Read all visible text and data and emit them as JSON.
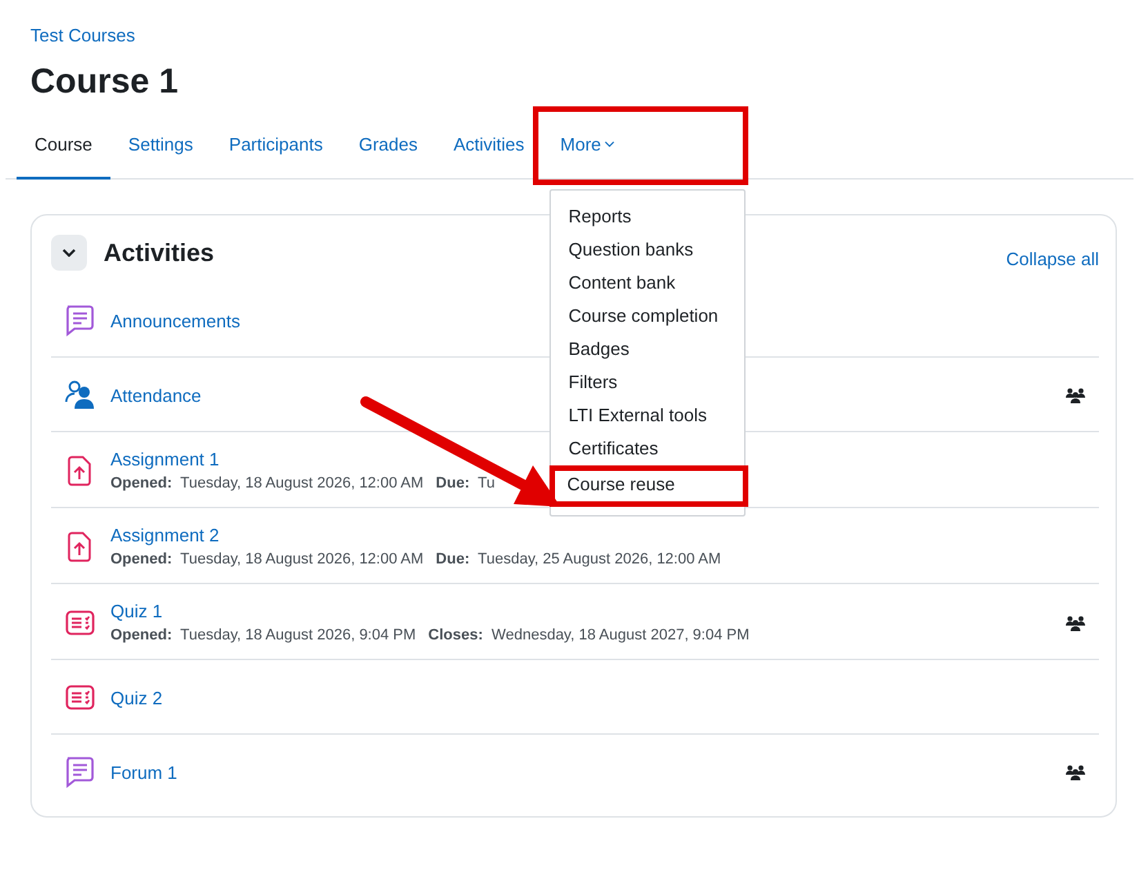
{
  "breadcrumb": "Test Courses",
  "title": "Course 1",
  "tabs": [
    {
      "label": "Course",
      "selected": true,
      "highlighted": false
    },
    {
      "label": "Settings",
      "selected": false,
      "highlighted": false
    },
    {
      "label": "Participants",
      "selected": false,
      "highlighted": false
    },
    {
      "label": "Grades",
      "selected": false,
      "highlighted": false
    },
    {
      "label": "Activities",
      "selected": false,
      "highlighted": false
    },
    {
      "label": "More",
      "selected": false,
      "highlighted": true,
      "caret": true
    }
  ],
  "more_menu": {
    "expanded": true,
    "items": [
      {
        "label": "Reports",
        "highlighted": false
      },
      {
        "label": "Question banks",
        "highlighted": false
      },
      {
        "label": "Content bank",
        "highlighted": false
      },
      {
        "label": "Course completion",
        "highlighted": false
      },
      {
        "label": "Badges",
        "highlighted": false
      },
      {
        "label": "Filters",
        "highlighted": false
      },
      {
        "label": "LTI External tools",
        "highlighted": false
      },
      {
        "label": "Certificates",
        "highlighted": false
      },
      {
        "label": "Course reuse",
        "highlighted": true
      }
    ]
  },
  "annotation_arrow": true,
  "section": {
    "title": "Activities",
    "expanded": true,
    "collapse_link": "Collapse all",
    "activities": [
      {
        "kind": "forum",
        "name": "Announcements",
        "groups": false
      },
      {
        "kind": "attendance",
        "name": "Attendance",
        "groups": true
      },
      {
        "kind": "assignment",
        "name": "Assignment 1",
        "groups": false,
        "dates": [
          {
            "label": "Opened:",
            "value": "Tuesday, 18 August 2026, 12:00 AM"
          },
          {
            "label": "Due:",
            "value": "Tu"
          }
        ]
      },
      {
        "kind": "assignment",
        "name": "Assignment 2",
        "groups": false,
        "dates": [
          {
            "label": "Opened:",
            "value": "Tuesday, 18 August 2026, 12:00 AM"
          },
          {
            "label": "Due:",
            "value": "Tuesday, 25 August 2026, 12:00 AM"
          }
        ]
      },
      {
        "kind": "quiz",
        "name": "Quiz 1",
        "groups": true,
        "dates": [
          {
            "label": "Opened:",
            "value": "Tuesday, 18 August 2026, 9:04 PM"
          },
          {
            "label": "Closes:",
            "value": "Wednesday, 18 August 2027, 9:04 PM"
          }
        ]
      },
      {
        "kind": "quiz",
        "name": "Quiz 2",
        "groups": false
      },
      {
        "kind": "forum",
        "name": "Forum 1",
        "groups": true
      }
    ]
  }
}
